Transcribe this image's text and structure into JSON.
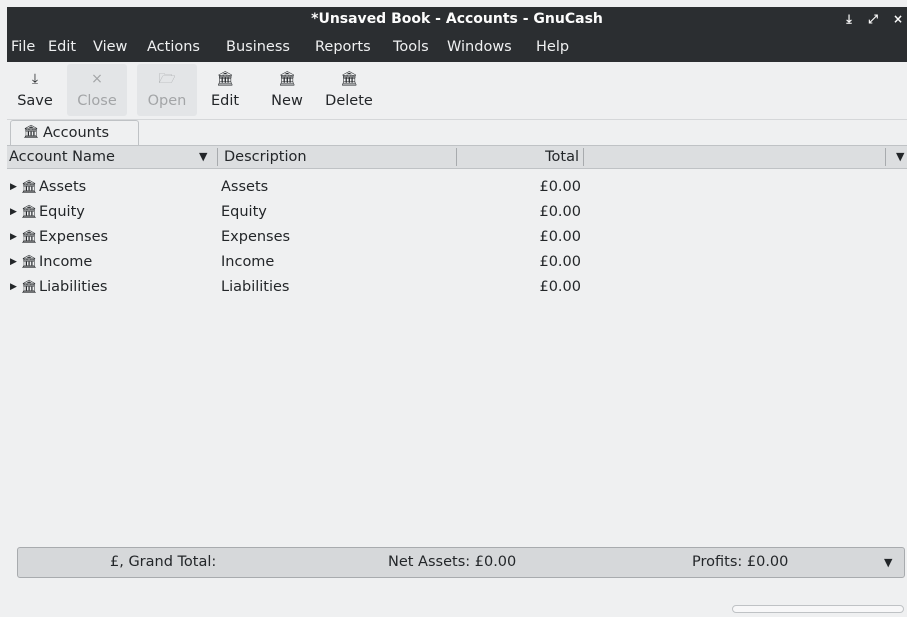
{
  "window": {
    "title": "*Unsaved Book - Accounts - GnuCash",
    "controls": {
      "minimize": "⤓",
      "maximize": "⤢",
      "close": "×"
    }
  },
  "menu": [
    "File",
    "Edit",
    "View",
    "Actions",
    "Business",
    "Reports",
    "Tools",
    "Windows",
    "Help"
  ],
  "toolbar": {
    "save": {
      "label": "Save",
      "icon": "⤓",
      "icon_name": "save-icon",
      "enabled": true
    },
    "close": {
      "label": "Close",
      "icon": "×",
      "icon_name": "close-icon",
      "enabled": false
    },
    "open": {
      "label": "Open",
      "icon": "🗁",
      "icon_name": "open-icon",
      "enabled": false
    },
    "edit": {
      "label": "Edit",
      "icon": "🏛",
      "icon_name": "edit-account-icon",
      "enabled": true
    },
    "new": {
      "label": "New",
      "icon": "🏛",
      "icon_name": "new-account-icon",
      "enabled": true
    },
    "delete": {
      "label": "Delete",
      "icon": "🏛",
      "icon_name": "delete-account-icon",
      "enabled": true
    }
  },
  "tab": {
    "label": "Accounts",
    "icon": "🏛"
  },
  "columns": {
    "account_name": "Account Name",
    "description": "Description",
    "total": "Total"
  },
  "accounts": [
    {
      "name": "Assets",
      "description": "Assets",
      "total": "£0.00"
    },
    {
      "name": "Equity",
      "description": "Equity",
      "total": "£0.00"
    },
    {
      "name": "Expenses",
      "description": "Expenses",
      "total": "£0.00"
    },
    {
      "name": "Income",
      "description": "Income",
      "total": "£0.00"
    },
    {
      "name": "Liabilities",
      "description": "Liabilities",
      "total": "£0.00"
    }
  ],
  "summary": {
    "grand_total": "£, Grand Total:",
    "net_assets": "Net Assets: £0.00",
    "profits": "Profits: £0.00"
  },
  "colors": {
    "titlebar": "#2b2e31",
    "background": "#eff0f1",
    "header": "#dcdee0"
  }
}
